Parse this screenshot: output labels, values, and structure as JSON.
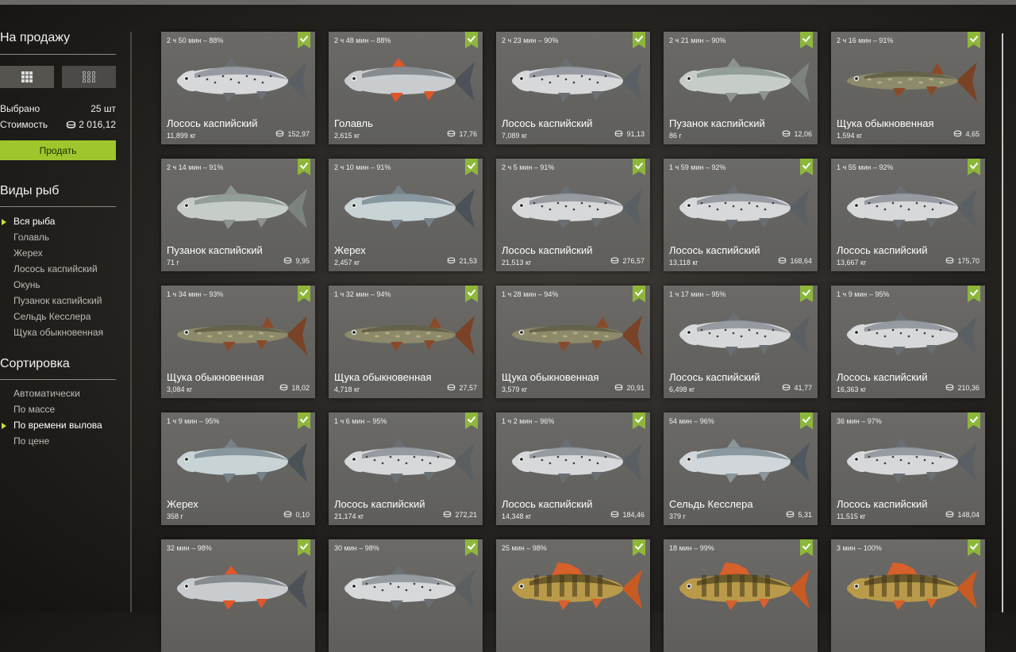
{
  "sidebar": {
    "for_sale_title": "На продажу",
    "selected_label": "Выбрано",
    "selected_value": "25 шт",
    "cost_label": "Стоимость",
    "cost_value": "2 016,12",
    "sell_button": "Продать",
    "species_title": "Виды рыб",
    "species": [
      {
        "label": "Вся рыба",
        "active": true
      },
      {
        "label": "Голавль",
        "active": false
      },
      {
        "label": "Жерех",
        "active": false
      },
      {
        "label": "Лосось каспийский",
        "active": false
      },
      {
        "label": "Окунь",
        "active": false
      },
      {
        "label": "Пузанок каспийский",
        "active": false
      },
      {
        "label": "Сельдь Кесслера",
        "active": false
      },
      {
        "label": "Щука обыкновенная",
        "active": false
      }
    ],
    "sort_title": "Сортировка",
    "sort": [
      {
        "label": "Автоматически",
        "active": false
      },
      {
        "label": "По массе",
        "active": false
      },
      {
        "label": "По времени вылова",
        "active": true
      },
      {
        "label": "По цене",
        "active": false
      }
    ]
  },
  "colors": {
    "accent": "#9fc62c",
    "check": "#8db73a",
    "card": "#676663"
  },
  "cards": [
    {
      "time": "2 ч 50 мин – 88%",
      "name": "Лосось каспийский",
      "mass": "11,899 кг",
      "price": "152,97",
      "fish": "salmon"
    },
    {
      "time": "2 ч 48 мин – 88%",
      "name": "Голавль",
      "mass": "2,615 кг",
      "price": "17,76",
      "fish": "chub"
    },
    {
      "time": "2 ч 23 мин – 90%",
      "name": "Лосось каспийский",
      "mass": "7,089 кг",
      "price": "91,13",
      "fish": "salmon"
    },
    {
      "time": "2 ч 21 мин – 90%",
      "name": "Пузанок каспийский",
      "mass": "86 г",
      "price": "12,06",
      "fish": "shad"
    },
    {
      "time": "2 ч 16 мин – 91%",
      "name": "Щука обыкновенная",
      "mass": "1,594 кг",
      "price": "4,65",
      "fish": "pike"
    },
    {
      "time": "2 ч 14 мин – 91%",
      "name": "Пузанок каспийский",
      "mass": "71 г",
      "price": "9,95",
      "fish": "shad"
    },
    {
      "time": "2 ч 10 мин – 91%",
      "name": "Жерех",
      "mass": "2,457 кг",
      "price": "21,53",
      "fish": "asp"
    },
    {
      "time": "2 ч 5 мин – 91%",
      "name": "Лосось каспийский",
      "mass": "21,513 кг",
      "price": "276,57",
      "fish": "salmon"
    },
    {
      "time": "1 ч 59 мин – 92%",
      "name": "Лосось каспийский",
      "mass": "13,118 кг",
      "price": "168,64",
      "fish": "salmon"
    },
    {
      "time": "1 ч 55 мин – 92%",
      "name": "Лосось каспийский",
      "mass": "13,667 кг",
      "price": "175,70",
      "fish": "salmon"
    },
    {
      "time": "1 ч 34 мин – 93%",
      "name": "Щука обыкновенная",
      "mass": "3,084 кг",
      "price": "18,02",
      "fish": "pike"
    },
    {
      "time": "1 ч 32 мин – 94%",
      "name": "Щука обыкновенная",
      "mass": "4,718 кг",
      "price": "27,57",
      "fish": "pike"
    },
    {
      "time": "1 ч 28 мин – 94%",
      "name": "Щука обыкновенная",
      "mass": "3,579 кг",
      "price": "20,91",
      "fish": "pike"
    },
    {
      "time": "1 ч 17 мин – 95%",
      "name": "Лосось каспийский",
      "mass": "6,498 кг",
      "price": "41,77",
      "fish": "salmon"
    },
    {
      "time": "1 ч 9 мин – 95%",
      "name": "Лосось каспийский",
      "mass": "16,363 кг",
      "price": "210,36",
      "fish": "salmon"
    },
    {
      "time": "1 ч 9 мин – 95%",
      "name": "Жерех",
      "mass": "358 г",
      "price": "0,10",
      "fish": "asp"
    },
    {
      "time": "1 ч 6 мин – 95%",
      "name": "Лосось каспийский",
      "mass": "21,174 кг",
      "price": "272,21",
      "fish": "salmon"
    },
    {
      "time": "1 ч 2 мин – 96%",
      "name": "Лосось каспийский",
      "mass": "14,348 кг",
      "price": "184,46",
      "fish": "salmon"
    },
    {
      "time": "54 мин – 96%",
      "name": "Сельдь Кесслера",
      "mass": "379 г",
      "price": "5,31",
      "fish": "herring"
    },
    {
      "time": "36 мин – 97%",
      "name": "Лосось каспийский",
      "mass": "11,515 кг",
      "price": "148,04",
      "fish": "salmon"
    },
    {
      "time": "32 мин – 98%",
      "name": "",
      "mass": "",
      "price": "",
      "fish": "chub"
    },
    {
      "time": "30 мин – 98%",
      "name": "",
      "mass": "",
      "price": "",
      "fish": "salmon"
    },
    {
      "time": "25 мин – 98%",
      "name": "",
      "mass": "",
      "price": "",
      "fish": "perch"
    },
    {
      "time": "18 мин – 99%",
      "name": "",
      "mass": "",
      "price": "",
      "fish": "perch"
    },
    {
      "time": "3 мин – 100%",
      "name": "",
      "mass": "",
      "price": "",
      "fish": "perch"
    }
  ]
}
